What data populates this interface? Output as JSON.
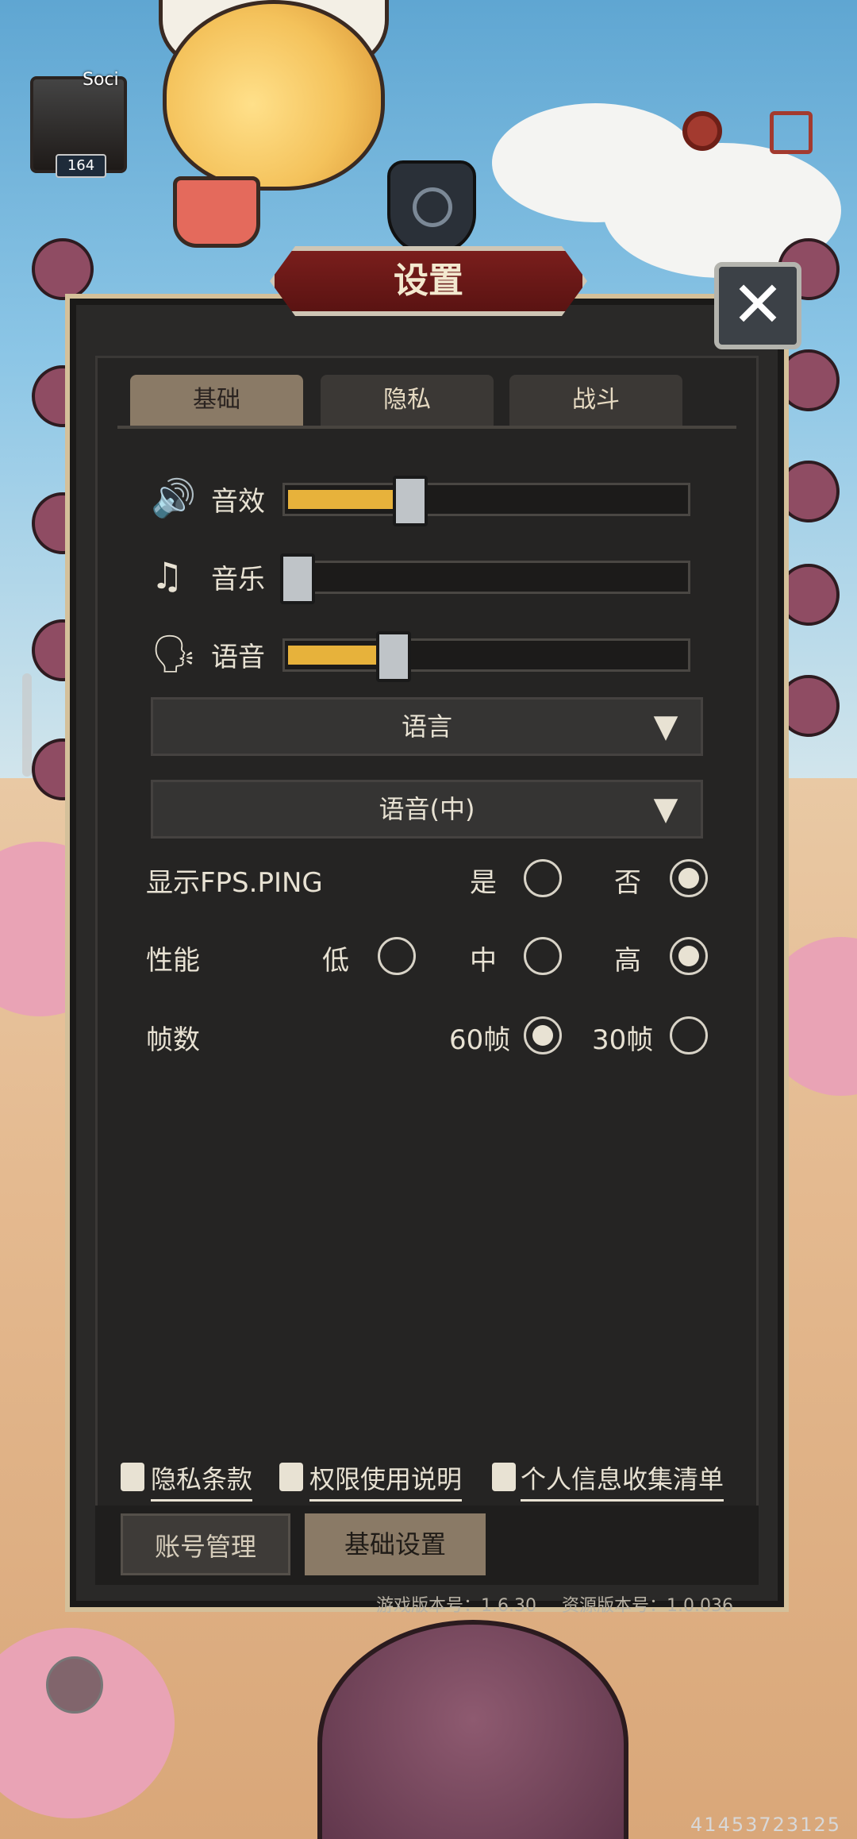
{
  "player": {
    "name": "Soci",
    "level": "164"
  },
  "dialog": {
    "title": "设置",
    "close_label": "✕"
  },
  "tabs": [
    {
      "label": "基础",
      "active": true
    },
    {
      "label": "隐私",
      "active": false
    },
    {
      "label": "战斗",
      "active": false
    }
  ],
  "sliders": [
    {
      "icon": "speaker-icon",
      "label": "音效",
      "value_percent": 28
    },
    {
      "icon": "music-muted-icon",
      "label": "音乐",
      "value_percent": 0
    },
    {
      "icon": "voice-icon",
      "label": "语音",
      "value_percent": 24
    }
  ],
  "dropdowns": {
    "language": {
      "label": "语言"
    },
    "voice": {
      "label": "语音(中)"
    }
  },
  "options": {
    "fps_ping": {
      "label": "显示FPS.PING",
      "choices": [
        "是",
        "否"
      ],
      "selected": "否"
    },
    "performance": {
      "label": "性能",
      "choices": [
        "低",
        "中",
        "高"
      ],
      "selected": "高"
    },
    "frame_rate": {
      "label": "帧数",
      "choices": [
        "60帧",
        "30帧"
      ],
      "selected": "60帧"
    }
  },
  "links": {
    "privacy_terms": "隐私条款",
    "permissions": "权限使用说明",
    "personal_info": "个人信息收集清单"
  },
  "bottom_tabs": [
    {
      "label": "账号管理",
      "active": false
    },
    {
      "label": "基础设置",
      "active": true
    }
  ],
  "version": {
    "game": "游戏版本号：1.6.30",
    "resource": "资源版本号：1.0.036"
  },
  "build_number": "41453723125",
  "colors": {
    "accent_fill": "#e7b23b",
    "banner_red": "#7a1e1c",
    "panel": "#252423"
  }
}
